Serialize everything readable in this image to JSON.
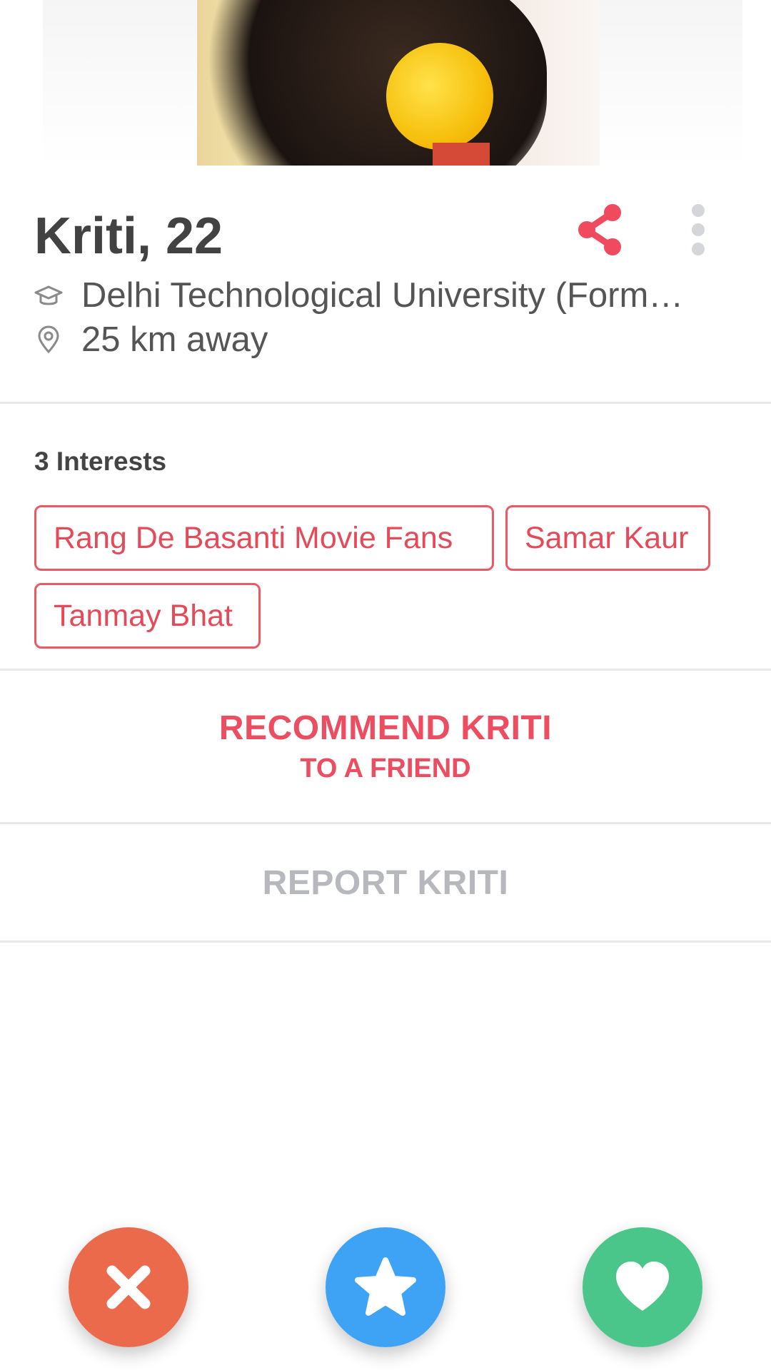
{
  "profile": {
    "name_age": "Kriti, 22",
    "school": "Delhi Technological University (Form…",
    "distance": "25 km away"
  },
  "interests": {
    "title": "3 Interests",
    "items": [
      {
        "label": "Rang De Basanti Movie Fans"
      },
      {
        "label": "Samar Kaur"
      },
      {
        "label": "Tanmay Bhat"
      }
    ]
  },
  "actions": {
    "recommend_line1": "RECOMMEND KRITI",
    "recommend_line2": "TO A FRIEND",
    "report": "REPORT KRITI"
  },
  "icons": {
    "share": "share-icon",
    "more": "more-vertical-icon",
    "school": "graduation-cap-icon",
    "location": "location-pin-icon",
    "nope": "close-icon",
    "super_like": "star-icon",
    "like": "heart-icon"
  },
  "colors": {
    "accent": "#ec4d61",
    "chip_border": "#ea5a64",
    "muted": "#b6b8bd",
    "nope": "#ec6a4c",
    "super_like": "#3ea3f5",
    "like": "#4bc68b"
  }
}
